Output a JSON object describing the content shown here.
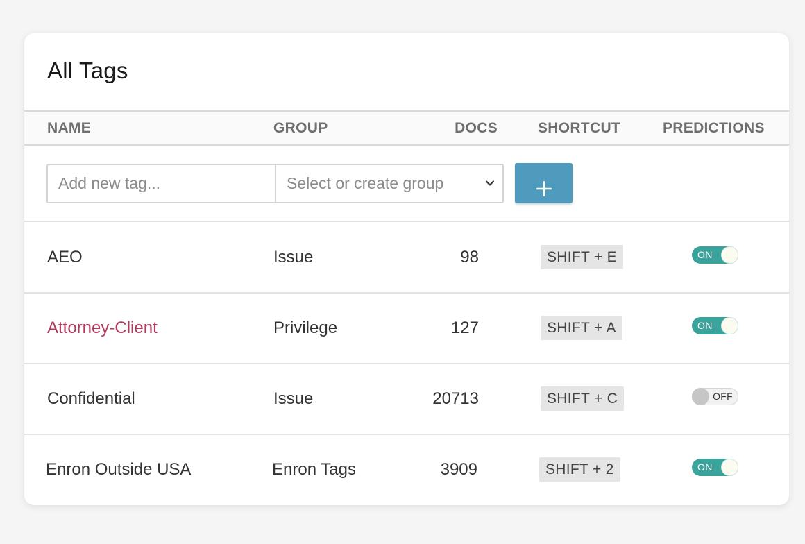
{
  "page": {
    "title": "All Tags"
  },
  "table": {
    "headers": {
      "name": "NAME",
      "group": "GROUP",
      "docs": "DOCS",
      "shortcut": "SHORTCUT",
      "predictions": "PREDICTIONS"
    },
    "add_row": {
      "tag_placeholder": "Add new tag...",
      "tag_value": "",
      "group_placeholder": "Select or create group",
      "add_button_label": "+"
    },
    "rows": [
      {
        "name": "AEO",
        "group": "Issue",
        "docs": "98",
        "shortcut": "SHIFT + E",
        "predictions": true,
        "prediction_label": "ON"
      },
      {
        "name": "Attorney-Client",
        "group": "Privilege",
        "docs": "127",
        "shortcut": "SHIFT + A",
        "predictions": true,
        "prediction_label": "ON"
      },
      {
        "name": "Confidential",
        "group": "Issue",
        "docs": "20713",
        "shortcut": "SHIFT + C",
        "predictions": false,
        "prediction_label": "OFF"
      },
      {
        "name": "Enron Outside USA",
        "group": "Enron Tags",
        "docs": "3909",
        "shortcut": "SHIFT + 2",
        "predictions": true,
        "prediction_label": "ON"
      }
    ]
  },
  "icons": {
    "add": "plus-icon",
    "dropdown": "chevron-down-icon"
  },
  "colors": {
    "accent_button": "#4f9bbd",
    "toggle_on": "#3aa39b",
    "link_text": "#b33a5a",
    "shortcut_bg": "#e5e5e5"
  }
}
